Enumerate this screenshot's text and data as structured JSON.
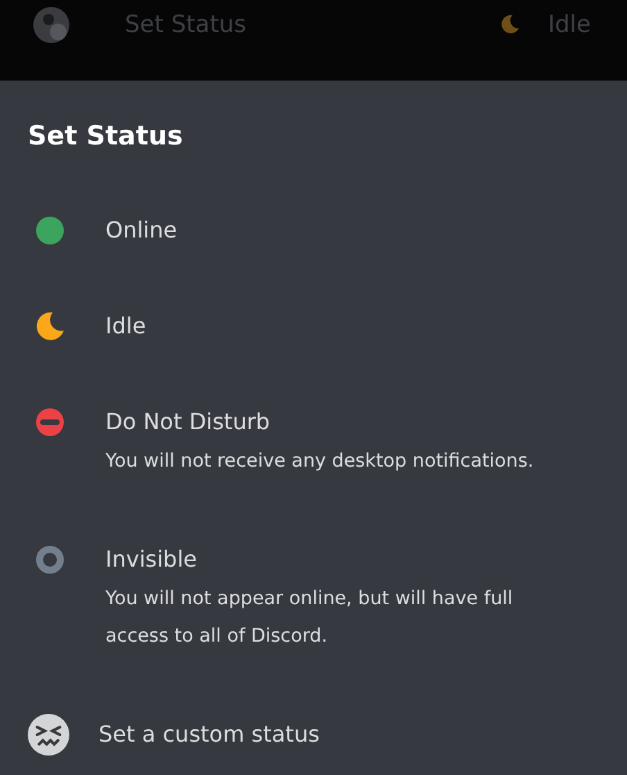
{
  "top_bar": {
    "title": "Set Status",
    "current_status": {
      "kind": "idle",
      "label": "Idle"
    }
  },
  "sheet": {
    "title": "Set Status",
    "options": [
      {
        "kind": "online",
        "label": "Online"
      },
      {
        "kind": "idle",
        "label": "Idle"
      },
      {
        "kind": "dnd",
        "label": "Do Not Disturb",
        "description": "You will not receive any desktop notifications."
      },
      {
        "kind": "invisible",
        "label": "Invisible",
        "description": "You will not appear online, but will have full access to all of Discord."
      },
      {
        "kind": "custom",
        "label": "Set a custom status"
      }
    ]
  }
}
